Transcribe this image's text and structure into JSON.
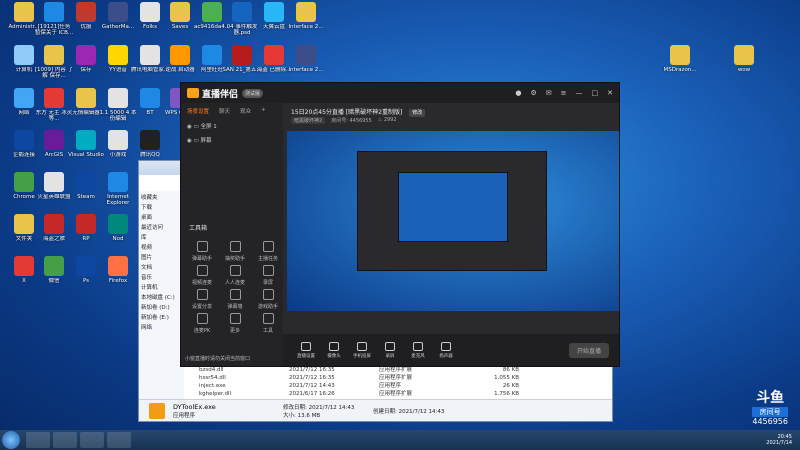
{
  "desktop": {
    "icons": [
      {
        "label": "Administr...",
        "color": "#e8c44a"
      },
      {
        "label": "[19121]任务 暂保关于 ICB...",
        "color": "#1e88e5"
      },
      {
        "label": "优服",
        "color": "#c0392b"
      },
      {
        "label": "GatherMa...",
        "color": "#3b4e8a"
      },
      {
        "label": "Folks",
        "color": "#e3e3e3"
      },
      {
        "label": "Saves",
        "color": "#e8c44a"
      },
      {
        "label": "ac9416da4...",
        "color": "#4caf50"
      },
      {
        "label": "04 事件触发器.psd",
        "color": "#1565c0"
      },
      {
        "label": "天翼云盘",
        "color": "#29b6f6"
      },
      {
        "label": "Interface 2...",
        "color": "#e8c44a"
      },
      {
        "label": "计算机",
        "color": "#90caf9"
      },
      {
        "label": "[1009] 内容 了解 保存...",
        "color": "#e8c44a"
      },
      {
        "label": "保存",
        "color": "#9c27b0"
      },
      {
        "label": "YY语音",
        "color": "#ffd600"
      },
      {
        "label": "腾讯电脑管家...",
        "color": "#e3e3e3"
      },
      {
        "label": "逆战 启动器",
        "color": "#ff9800"
      },
      {
        "label": "阿里旺旺",
        "color": "#1e88e5"
      },
      {
        "label": "SAN 21_第五...",
        "color": "#b71c1c"
      },
      {
        "label": "海盗 已删除...",
        "color": "#e53935"
      },
      {
        "label": "Interface 2...",
        "color": "#3b4e8a"
      },
      {
        "label": "网络",
        "color": "#42a5f5"
      },
      {
        "label": "东方 无主 冰灵 等...",
        "color": "#e53935"
      },
      {
        "label": "无情编辑器",
        "color": "#e8c44a"
      },
      {
        "label": "1.1 5000 4 本份编辑",
        "color": "#e3e3e3"
      },
      {
        "label": "BT",
        "color": "#1e88e5"
      },
      {
        "label": "WPS Office",
        "color": "#7e57c2"
      },
      {
        "label": "回收站",
        "color": "#cfd8dc"
      },
      {
        "label": "迅雷影音",
        "color": "#e53935"
      },
      {
        "label": "Adobe Illustr...",
        "color": "#ff8f00"
      },
      {
        "label": "FlashBlast",
        "color": "#1565c0"
      },
      {
        "label": "企鹅连接",
        "color": "#0d47a1"
      },
      {
        "label": "ArcGIS",
        "color": "#6a1b9a"
      },
      {
        "label": "Visual Studio",
        "color": "#00acc1"
      },
      {
        "label": "小游戏",
        "color": "#e3e3e3"
      },
      {
        "label": "腾讯QQ",
        "color": "#212121"
      },
      {
        "label": "Chrome",
        "color": "#43a047"
      },
      {
        "label": "火星英雄联盟",
        "color": "#e3e3e3"
      },
      {
        "label": "Steam",
        "color": "#0d47a1"
      },
      {
        "label": "Internet Explorer",
        "color": "#1e88e5"
      },
      {
        "label": "文件夹",
        "color": "#e8c44a"
      },
      {
        "label": "文件夹",
        "color": "#e8c44a"
      },
      {
        "label": "海盗之旅",
        "color": "#c62828"
      },
      {
        "label": "RP",
        "color": "#c62828"
      },
      {
        "label": "Nod",
        "color": "#00897b"
      },
      {
        "label": "腾讯",
        "color": "#f9a825"
      },
      {
        "label": "X",
        "color": "#e53935"
      },
      {
        "label": "微信",
        "color": "#43a047"
      },
      {
        "label": "Ps",
        "color": "#0d47a1"
      },
      {
        "label": "Firefox",
        "color": "#ff7043"
      },
      {
        "label": "世界",
        "color": "#e3e3e3"
      }
    ],
    "right_icons": [
      {
        "label": "MSDrazon...",
        "color": "#e8c44a"
      },
      {
        "label": "wow",
        "color": "#e8c44a"
      }
    ]
  },
  "explorer": {
    "nav_items": [
      "收藏夹",
      "下载",
      "桌面",
      "最近访问",
      "库",
      "视频",
      "图片",
      "文档",
      "音乐",
      "计算机",
      "本地磁盘 (C:)",
      "新加卷 (D:)",
      "新加卷 (E:)",
      "网络"
    ],
    "files": [
      {
        "name": "bzsd4.dll",
        "date": "2021/7/12 16:35",
        "type": "应用程序扩展",
        "size": "86 KB"
      },
      {
        "name": "hssr54.dll",
        "date": "2021/7/12 16:35",
        "type": "应用程序扩展",
        "size": "1,055 KB"
      },
      {
        "name": "inject.exe",
        "date": "2021/7/12 14:43",
        "type": "应用程序",
        "size": "26 KB"
      },
      {
        "name": "kghelper.dll",
        "date": "2021/6/17 16:26",
        "type": "应用程序扩展",
        "size": "1,756 KB"
      }
    ],
    "status": {
      "filename": "DYToolEx.exe",
      "modified_label": "修改日期: 2021/7/12 14:43",
      "created_label": "创建日期: 2021/7/12 14:43",
      "type": "应用程序",
      "size": "大小: 13.6 MB"
    }
  },
  "app": {
    "name": "直播伴侣",
    "badge": "测试版",
    "tabs": [
      "场景设置",
      "聊天",
      "观众",
      "+"
    ],
    "scene1": "全屏 1",
    "scene2": "屏幕",
    "tools_title": "工具箱",
    "tools": [
      {
        "label": "弹幕助手"
      },
      {
        "label": "抽奖助手"
      },
      {
        "label": "主播任务"
      },
      {
        "label": "视频连麦"
      },
      {
        "label": "人人连麦"
      },
      {
        "label": "录屏"
      },
      {
        "label": "设置分享"
      },
      {
        "label": "弹幕墙"
      },
      {
        "label": "游戏助手"
      },
      {
        "label": "连麦PK"
      },
      {
        "label": "更多"
      },
      {
        "label": "工具"
      }
    ],
    "bottom_tip": "小窗直播时请勿关闭当前窗口",
    "stream_title": "15日20点45分直播 [暗黑破坏神2重制版]",
    "edit_tag": "修改",
    "category": "暗黑破坏神2",
    "room_label": "房间号: 4456955",
    "viewer_count": "2992",
    "controls": [
      {
        "label": "直播设置"
      },
      {
        "label": "摄像头"
      },
      {
        "label": "手机投屏"
      },
      {
        "label": "录屏"
      },
      {
        "label": "麦克风"
      },
      {
        "label": "扬声器"
      }
    ],
    "start_label": "开始直播"
  },
  "overlay": {
    "brand": "斗鱼",
    "room_word": "房间号",
    "room_num": "4456956"
  },
  "tray": {
    "time": "20:45",
    "date": "2021/7/14"
  }
}
